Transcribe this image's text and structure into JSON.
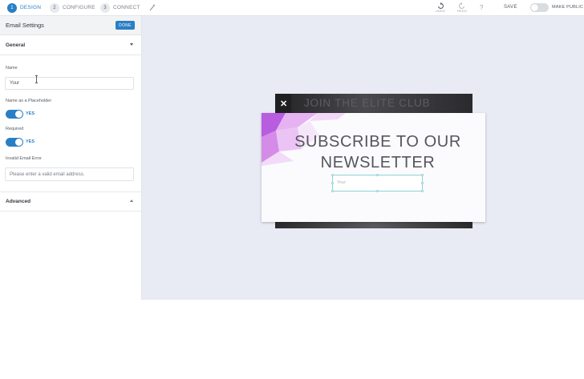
{
  "topbar": {
    "steps": [
      {
        "num": "1",
        "label": "DESIGN",
        "active": true
      },
      {
        "num": "2",
        "label": "CONFIGURE",
        "active": false
      },
      {
        "num": "3",
        "label": "CONNECT",
        "active": false
      }
    ],
    "undo_label": "UNDO",
    "redo_label": "REDO",
    "help_label": "?",
    "save_label": "SAVE",
    "make_public_label": "MAKE PUBLIC",
    "make_public_on": false,
    "accent": "#2a7fc4"
  },
  "sidebar": {
    "title": "Email Settings",
    "done_label": "DONE",
    "general_label": "General",
    "fields": {
      "name_label": "Name",
      "name_value": "Your",
      "placeholder_toggle_label": "Name as a Placeholder",
      "placeholder_toggle_state": "YES",
      "required_label": "Required",
      "required_state": "YES",
      "invalid_label": "Invalid Email Error",
      "invalid_value": "Please enter a valid email address."
    },
    "advanced_label": "Advanced"
  },
  "canvas": {
    "back_title": "JOIN THE ELITE CLUB",
    "close_glyph": "✕",
    "headline_line1": "SUBSCRIBE TO OUR",
    "headline_line2": "NEWSLETTER",
    "field_placeholder": "Your"
  }
}
